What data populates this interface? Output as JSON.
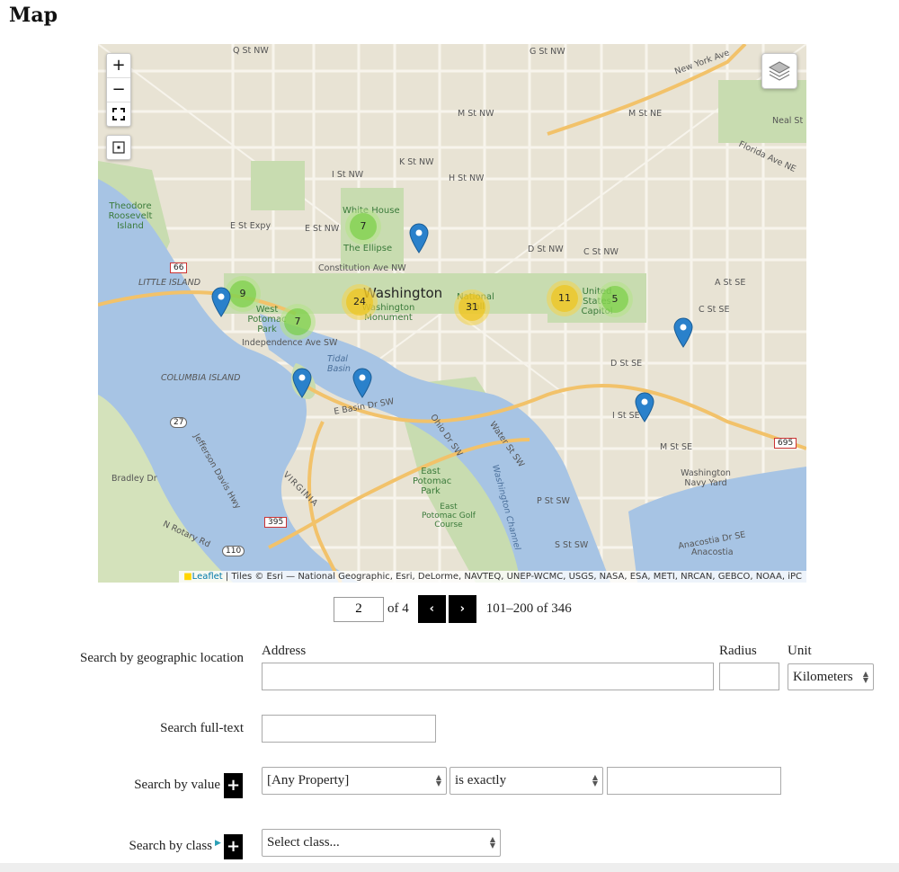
{
  "page": {
    "title": "Map"
  },
  "map": {
    "zoom_in": "+",
    "zoom_out": "−",
    "attribution_link": "Leaflet",
    "attribution_text": " | Tiles © Esri — National Geographic, Esri, DeLorme, NAVTEQ, UNEP-WCMC, USGS, NASA, ESA, METI, NRCAN, GEBCO, NOAA, iPC",
    "clusters": [
      "9",
      "7",
      "24",
      "7",
      "31",
      "11",
      "5"
    ],
    "labels": {
      "washington": "Washington",
      "white_house": "White House",
      "ellipse": "The Ellipse",
      "wa_monument": "Washington Monument",
      "national_mall": "National Mall",
      "capitol": "United States Capitol",
      "theodore": "Theodore Roosevelt Island",
      "little_island": "LITTLE ISLAND",
      "columbia_island": "COLUMBIA ISLAND",
      "west_potomac": "West Potomac Park",
      "east_potomac": "East Potomac Park",
      "golf": "East Potomac Golf Course",
      "tidal_basin": "Tidal Basin",
      "virginia": "VIRGINIA",
      "navy_yard": "Washington Navy Yard",
      "anacostia": "Anacostia",
      "newyork_ave": "New York Ave",
      "constitution": "Constitution Ave NW",
      "independence": "Independence Ave SW",
      "e_basin": "E Basin Dr SW",
      "ohio_dr": "Ohio Dr SW",
      "water_st": "Water St SW",
      "washington_channel": "Washington Channel",
      "jefferson_davis": "Jefferson Davis Hwy",
      "bradley": "Bradley Dr",
      "rotary": "N Rotary Rd",
      "e_st_expy": "E St Expy",
      "e_st_nw": "E St NW",
      "h_st_nw": "H St NW",
      "i_st_nw": "I St NW",
      "k_st_nw": "K St NW",
      "m_st_nw": "M St NW",
      "q_st_nw": "Q St NW",
      "g_st_nw": "G St NW",
      "d_st_nw": "D St NW",
      "c_st_nw": "C St NW",
      "m_st_ne": "M St NE",
      "a_st_se": "A St SE",
      "c_st_se": "C St SE",
      "d_st_se": "D St SE",
      "i_st_se": "I St SE",
      "m_st_se": "M St SE",
      "p_st_sw": "P St SW",
      "s_st_sw": "S St SW",
      "florida_ave": "Florida Ave NE",
      "neal_st": "Neal St NE",
      "anacostia_dr": "Anacostia Dr SE",
      "route_66": "66",
      "route_695": "695",
      "route_395": "395",
      "route_27": "27",
      "route_110": "110"
    }
  },
  "pager": {
    "page_value": "2",
    "of_text": "of 4",
    "prev_icon": "‹",
    "next_icon": "›",
    "range_text": "101–200 of 346"
  },
  "form": {
    "geo_label": "Search by geographic location",
    "address_label": "Address",
    "radius_label": "Radius",
    "unit_label": "Unit",
    "unit_value": "Kilometers",
    "fulltext_label": "Search full-text",
    "value_label": "Search by value",
    "property_value": "[Any Property]",
    "operator_value": "is exactly",
    "class_label": "Search by class",
    "class_value": "Select class...",
    "plus": "+"
  }
}
